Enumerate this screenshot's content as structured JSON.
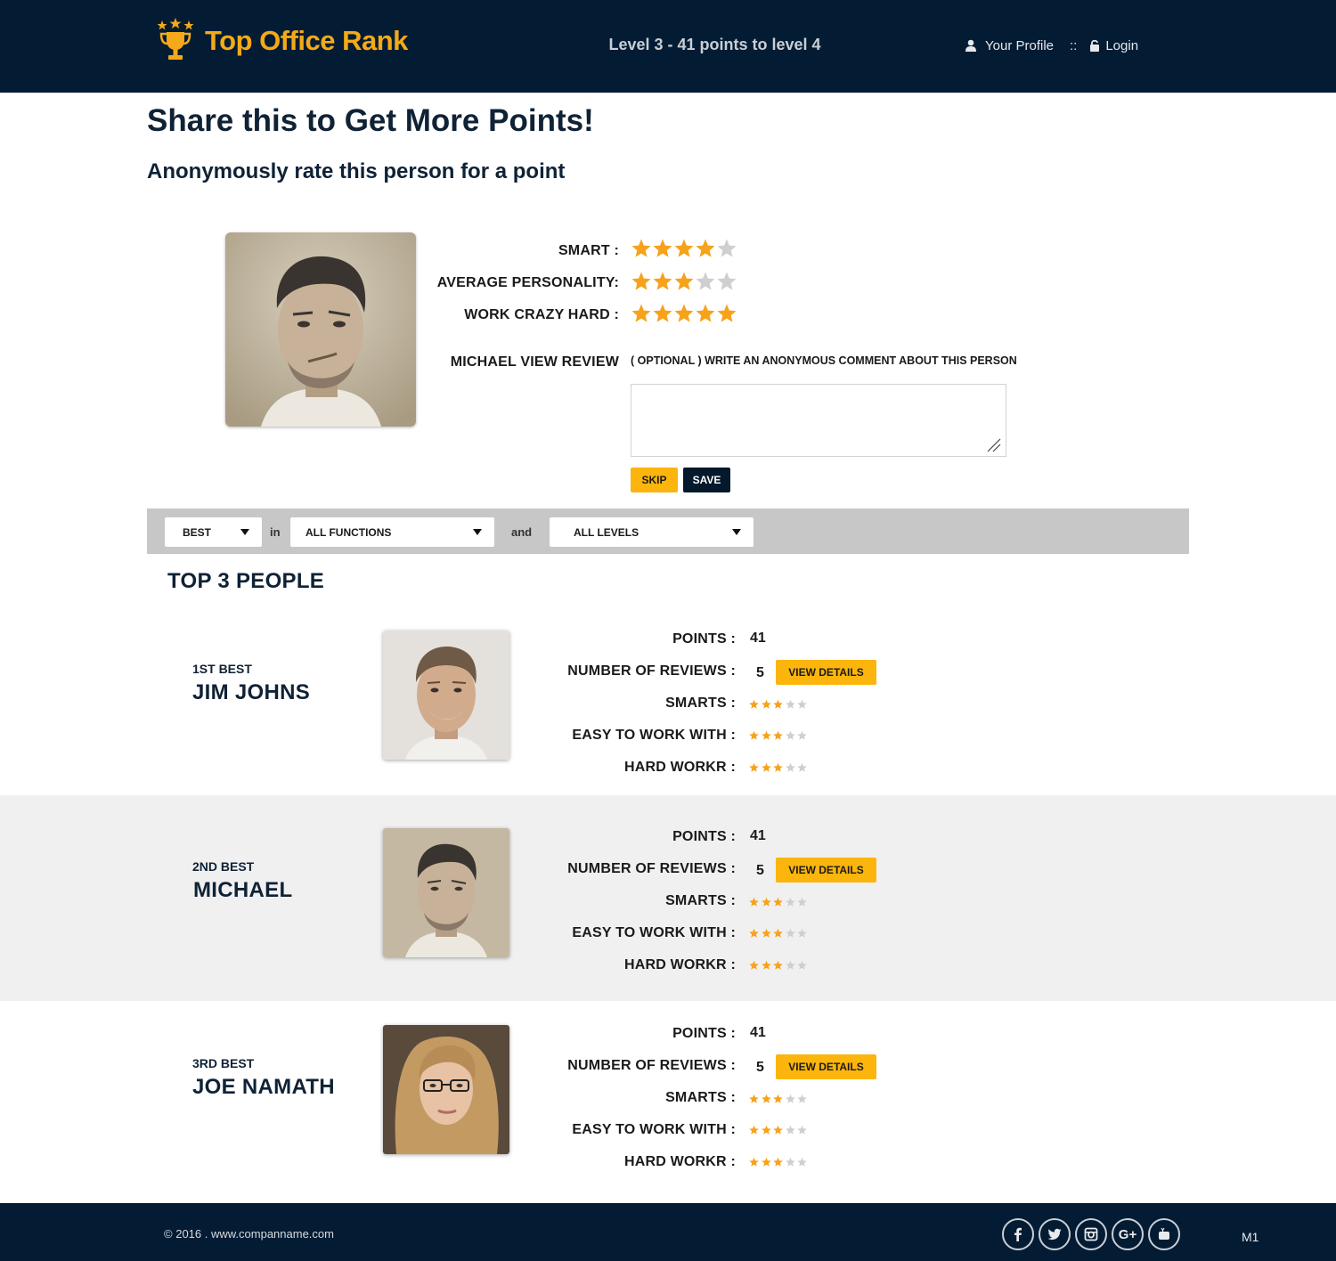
{
  "header": {
    "logo_text": "Top Office Rank",
    "level_text": "Level 3 - 41 points to level 4",
    "profile_link": "Your Profile",
    "separator": "::",
    "login_link": "Login"
  },
  "page": {
    "title": "Share this to Get More Points!",
    "subtitle": "Anonymously rate this person for a point"
  },
  "rating_form": {
    "criteria": [
      {
        "label": "SMART :",
        "rating": 4,
        "max": 5
      },
      {
        "label": "AVERAGE PERSONALITY:",
        "rating": 3,
        "max": 5
      },
      {
        "label": "WORK CRAZY HARD :",
        "rating": 5,
        "max": 5
      }
    ],
    "review_label": "MICHAEL VIEW REVIEW",
    "comment_hint": "( OPTIONAL ) WRITE AN ANONYMOUS COMMENT ABOUT THIS PERSON",
    "comment_value": "",
    "skip_label": "SKIP",
    "save_label": "SAVE"
  },
  "filters": {
    "sort": "BEST",
    "connector_in": "in",
    "function": "ALL FUNCTIONS",
    "connector_and": "and",
    "level": "ALL LEVELS"
  },
  "top3": {
    "heading": "TOP 3 PEOPLE",
    "labels": {
      "points": "POINTS :",
      "reviews": "NUMBER OF REVIEWS :",
      "smarts": "SMARTS :",
      "easy": "EASY TO WORK WITH :",
      "hard": "HARD WORKR :"
    },
    "view_details_label": "VIEW DETAILS",
    "people": [
      {
        "rank": "1ST BEST",
        "name": "JIM JOHNS",
        "points": "41",
        "reviews": "5",
        "smarts": 3,
        "easy": 3,
        "hard": 3
      },
      {
        "rank": "2ND BEST",
        "name": "MICHAEL",
        "points": "41",
        "reviews": "5",
        "smarts": 3,
        "easy": 3,
        "hard": 3
      },
      {
        "rank": "3RD BEST",
        "name": "JOE NAMATH",
        "points": "41",
        "reviews": "5",
        "smarts": 3,
        "easy": 3,
        "hard": 3
      }
    ]
  },
  "footer": {
    "copyright": "2016 . www.companname.com",
    "social": [
      "facebook-icon",
      "twitter-icon",
      "instagram-icon",
      "google-plus-icon",
      "youtube-icon"
    ],
    "badge": "M1"
  },
  "colors": {
    "navy": "#031c33",
    "accent": "#fbb50c",
    "star_on": "#f7a21b",
    "star_off": "#cfcfcf"
  }
}
